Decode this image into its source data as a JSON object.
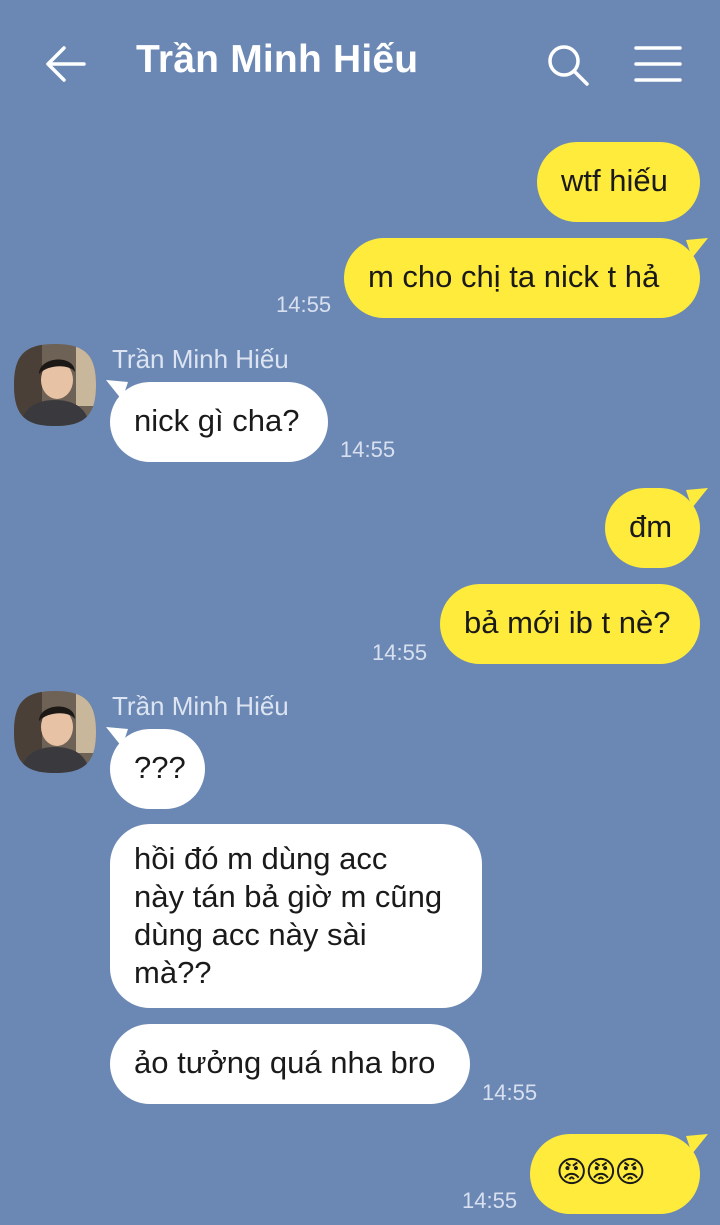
{
  "header": {
    "title": "Trần Minh Hiếu",
    "back_icon": "back-arrow-icon",
    "search_icon": "search-icon",
    "menu_icon": "menu-icon"
  },
  "colors": {
    "background": "#6b88b4",
    "my_bubble": "#ffeb3b",
    "their_bubble": "#ffffff"
  },
  "messages": [
    {
      "from": "me",
      "text": "wtf hiếu"
    },
    {
      "from": "me",
      "text": "m cho chị ta nick t hả",
      "time": "14:55"
    },
    {
      "from": "other",
      "sender": "Trần Minh Hiếu",
      "text": "nick gì cha?",
      "time": "14:55"
    },
    {
      "from": "me",
      "text": "đm"
    },
    {
      "from": "me",
      "text": "bả mới ib t nè?",
      "time": "14:55"
    },
    {
      "from": "other",
      "sender": "Trần Minh Hiếu",
      "text": "???"
    },
    {
      "from": "other",
      "text": "hồi đó m dùng acc\nnày tán bả giờ m cũng\ndùng acc này sài\nmà??"
    },
    {
      "from": "other",
      "text": "ảo tưởng quá nha bro",
      "time": "14:55"
    },
    {
      "from": "me",
      "text": "😡😡😡",
      "time": "14:55"
    }
  ]
}
